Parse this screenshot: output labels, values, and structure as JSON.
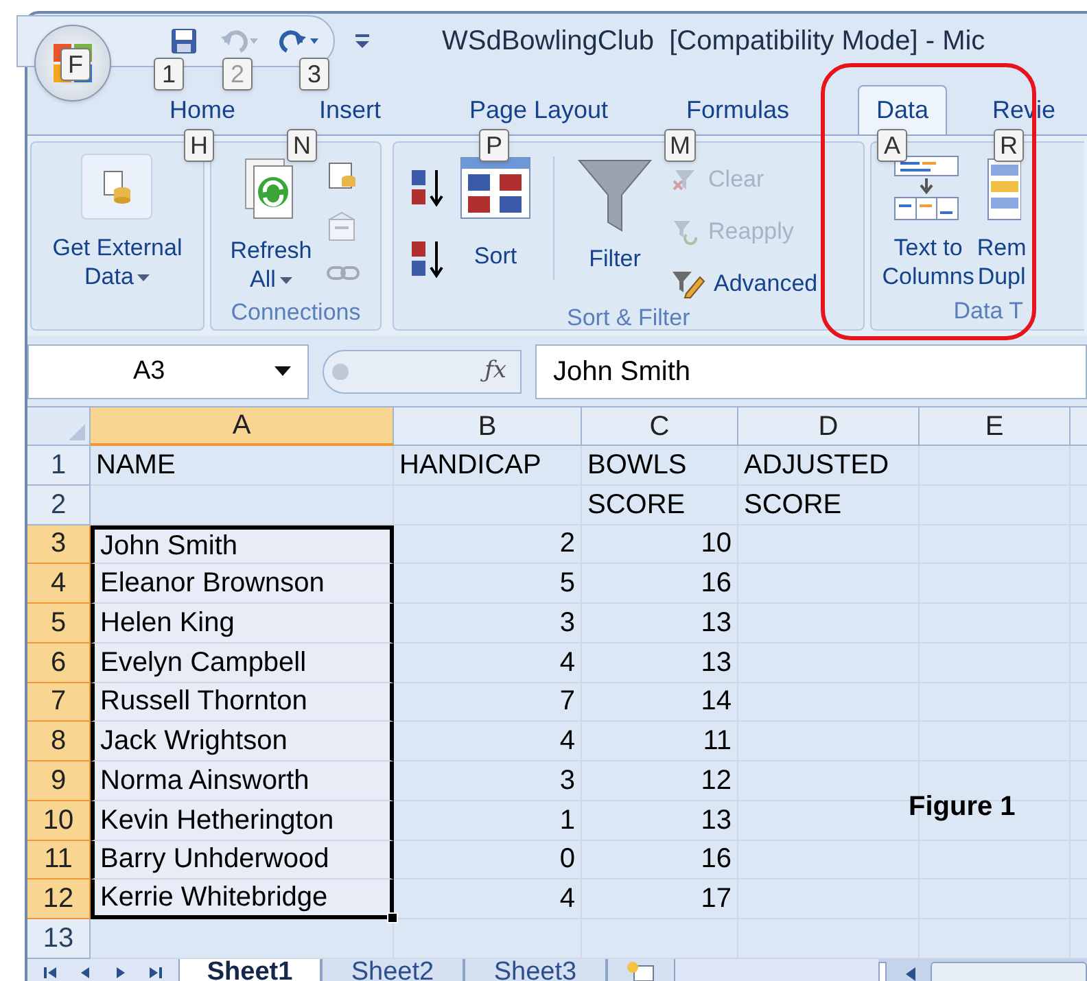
{
  "title_bar": {
    "title": "WSdBowlingClub  [Compatibility Mode] - Mic",
    "office_keytip": "F",
    "quick_access": [
      {
        "kind": "save",
        "keytip": "1",
        "disabled": false
      },
      {
        "kind": "undo",
        "keytip": "2",
        "disabled": true
      },
      {
        "kind": "redo",
        "keytip": "3",
        "disabled": false
      }
    ]
  },
  "tabs": [
    {
      "label": "Home",
      "keytip": "H",
      "selected": false
    },
    {
      "label": "Insert",
      "keytip": "N",
      "selected": false
    },
    {
      "label": "Page Layout",
      "keytip": "P",
      "selected": false
    },
    {
      "label": "Formulas",
      "keytip": "M",
      "selected": false
    },
    {
      "label": "Data",
      "keytip": "A",
      "selected": true
    },
    {
      "label": "Revie",
      "keytip": "R",
      "selected": false
    }
  ],
  "ribbon": {
    "get_external_data": {
      "lines": [
        "Get External",
        "Data"
      ]
    },
    "connections": {
      "label": "Connections",
      "refresh": {
        "lines": [
          "Refresh",
          "All"
        ]
      }
    },
    "sort_filter": {
      "label": "Sort & Filter",
      "sort": "Sort",
      "filter": "Filter",
      "small_buttons": [
        {
          "kind": "clear",
          "label": "Clear",
          "disabled": true
        },
        {
          "kind": "reapply",
          "label": "Reapply",
          "disabled": true
        },
        {
          "kind": "advanced",
          "label": "Advanced",
          "disabled": false
        }
      ]
    },
    "data_tools": {
      "label": "Data T",
      "text_to_columns": {
        "lines": [
          "Text to",
          "Columns"
        ]
      },
      "remove_duplicates": {
        "lines": [
          "Rem",
          "Dupl"
        ]
      }
    }
  },
  "formula_bar": {
    "name_box": "A3",
    "function_label": "ƒx",
    "formula": "John Smith"
  },
  "sheet": {
    "columns": [
      {
        "label": "A",
        "selected": true
      },
      {
        "label": "B",
        "selected": false
      },
      {
        "label": "C",
        "selected": false
      },
      {
        "label": "D",
        "selected": false
      },
      {
        "label": "E",
        "selected": false
      }
    ],
    "rows": [
      {
        "number": "1",
        "kind": "header",
        "selected": false,
        "cells": {
          "A": "NAME",
          "B": "HANDICAP",
          "C": "BOWLS",
          "D": "ADJUSTED"
        }
      },
      {
        "number": "2",
        "kind": "header",
        "selected": false,
        "cells": {
          "C": "SCORE",
          "D": "SCORE"
        }
      },
      {
        "number": "3",
        "kind": "data",
        "selected": true,
        "cells": {
          "A": "John Smith",
          "B": "2",
          "C": "10"
        }
      },
      {
        "number": "4",
        "kind": "data",
        "selected": true,
        "cells": {
          "A": "Eleanor Brownson",
          "B": "5",
          "C": "16"
        }
      },
      {
        "number": "5",
        "kind": "data",
        "selected": true,
        "cells": {
          "A": "Helen King",
          "B": "3",
          "C": "13"
        }
      },
      {
        "number": "6",
        "kind": "data",
        "selected": true,
        "cells": {
          "A": "Evelyn Campbell",
          "B": "4",
          "C": "13"
        }
      },
      {
        "number": "7",
        "kind": "data",
        "selected": true,
        "cells": {
          "A": "Russell Thornton",
          "B": "7",
          "C": "14"
        }
      },
      {
        "number": "8",
        "kind": "data",
        "selected": true,
        "cells": {
          "A": "Jack Wrightson",
          "B": "4",
          "C": "11"
        }
      },
      {
        "number": "9",
        "kind": "data",
        "selected": true,
        "cells": {
          "A": "Norma Ainsworth",
          "B": "3",
          "C": "12"
        }
      },
      {
        "number": "10",
        "kind": "data",
        "selected": true,
        "cells": {
          "A": "Kevin Hetherington",
          "B": "1",
          "C": "13"
        }
      },
      {
        "number": "11",
        "kind": "data",
        "selected": true,
        "cells": {
          "A": "Barry Unhderwood",
          "B": "0",
          "C": "16"
        }
      },
      {
        "number": "12",
        "kind": "data",
        "selected": true,
        "cells": {
          "A": "Kerrie Whitebridge",
          "B": "4",
          "C": "17"
        }
      },
      {
        "number": "13",
        "kind": "data",
        "selected": false,
        "cells": {}
      }
    ]
  },
  "sheet_tabs": [
    {
      "label": "Sheet1",
      "selected": true
    },
    {
      "label": "Sheet2",
      "selected": false
    },
    {
      "label": "Sheet3",
      "selected": false
    }
  ],
  "caption": "Figure 1"
}
